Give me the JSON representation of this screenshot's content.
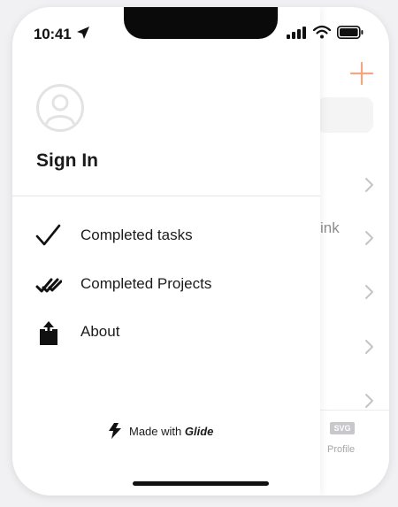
{
  "status_bar": {
    "time": "10:41"
  },
  "drawer": {
    "sign_in_label": "Sign In",
    "menu_items": [
      {
        "label": "Completed tasks",
        "icon": "checkmark-icon"
      },
      {
        "label": "Completed Projects",
        "icon": "double-checkmark-icon"
      },
      {
        "label": "About",
        "icon": "share-icon"
      }
    ],
    "footer": {
      "made_with": "Made with",
      "brand": "Glide"
    }
  },
  "background_screen": {
    "partial_text": "ink",
    "tab_badge": "SVG",
    "tab_label": "Profile"
  },
  "colors": {
    "accent": "#f4a582",
    "text": "#1c1c1e",
    "muted": "#8c8c90"
  }
}
